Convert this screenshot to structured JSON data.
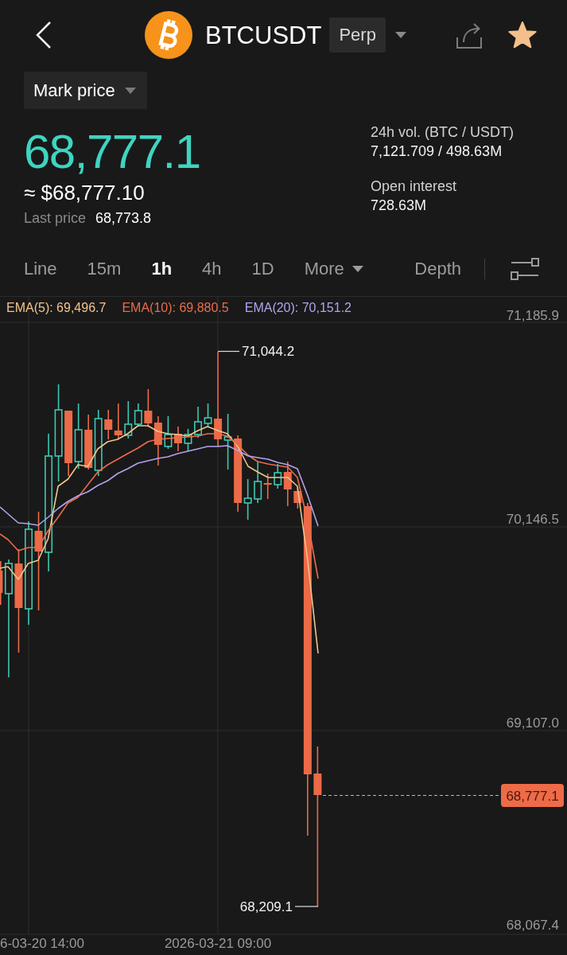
{
  "header": {
    "symbol": "BTCUSDT",
    "contract_type": "Perp",
    "starred": true
  },
  "price_source": {
    "label": "Mark price"
  },
  "price": {
    "value": "68,777.1",
    "approx_value": "≈ $68,777.10",
    "last_price_label": "Last price",
    "last_price": "68,773.8"
  },
  "stats": [
    {
      "label": "24h vol. (BTC / USDT)",
      "value": "7,121.709 / 498.63M"
    },
    {
      "label": "Open interest",
      "value": "728.63M"
    }
  ],
  "chart_tabs": [
    {
      "label": "Line",
      "kind": "tab",
      "selected": false
    },
    {
      "label": "15m",
      "kind": "tab",
      "selected": false
    },
    {
      "label": "1h",
      "kind": "tab",
      "selected": true
    },
    {
      "label": "4h",
      "kind": "tab",
      "selected": false
    },
    {
      "label": "1D",
      "kind": "tab",
      "selected": false
    },
    {
      "label": "More",
      "kind": "dropdown",
      "selected": false
    },
    {
      "label": "Depth",
      "kind": "tab",
      "selected": false
    }
  ],
  "chart": {
    "indicators": [
      {
        "label": "EMA(5): 69,496.7",
        "color": "#f2c48a"
      },
      {
        "label": "EMA(10): 69,880.5",
        "color": "#ea6c4c"
      },
      {
        "label": "EMA(20): 70,151.2",
        "color": "#b4a2ee"
      }
    ],
    "y_axis_labels": [
      "71,185.9",
      "70,146.5",
      "69,107.0",
      "68,067.4"
    ],
    "x_axis_labels": [
      "6-03-20 14:00",
      "2026-03-21 09:00"
    ],
    "high_label": "71,044.2",
    "low_label": "68,209.1",
    "current_price": "68,777.1"
  }
}
